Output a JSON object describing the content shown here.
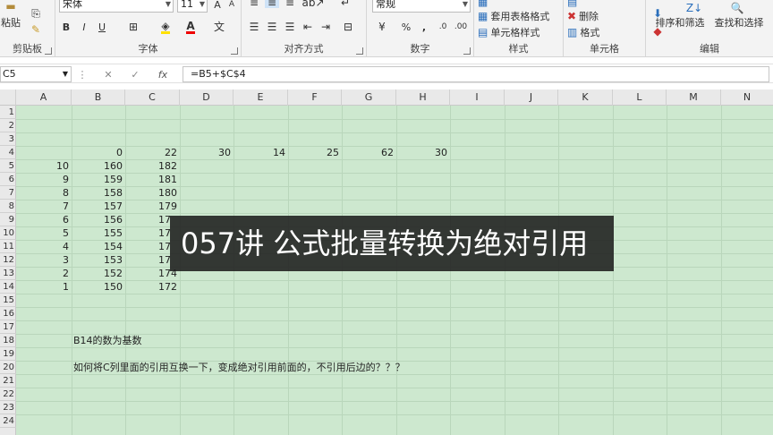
{
  "ribbon": {
    "clipboard": {
      "paste": "粘贴",
      "label": "剪贴板"
    },
    "font": {
      "name": "宋体",
      "size": "11",
      "bold": "B",
      "italic": "I",
      "underline": "U",
      "label": "字体"
    },
    "alignment": {
      "label": "对齐方式"
    },
    "number": {
      "format": "常规",
      "percent": "%",
      "comma": ",",
      "label": "数字"
    },
    "styles": {
      "table_format": "套用表格格式",
      "cell_styles": "单元格样式",
      "label": "样式"
    },
    "cells": {
      "delete": "删除",
      "format": "格式",
      "label": "单元格"
    },
    "editing": {
      "sort_filter": "排序和筛选",
      "find_select": "查找和选择",
      "label": "编辑"
    }
  },
  "formula_bar": {
    "name_box": "C5",
    "cancel": "✕",
    "enter": "✓",
    "fx": "fx",
    "formula": "=B5+$C$4"
  },
  "columns": [
    "A",
    "B",
    "C",
    "D",
    "E",
    "F",
    "G",
    "H",
    "I",
    "J",
    "K",
    "L",
    "M",
    "N"
  ],
  "rows": [
    "1",
    "2",
    "3",
    "4",
    "5",
    "6",
    "7",
    "8",
    "9",
    "10",
    "11",
    "12",
    "13",
    "14",
    "15",
    "16",
    "17",
    "18",
    "19",
    "20",
    "21",
    "22",
    "23",
    "24"
  ],
  "row4": [
    "0",
    "22",
    "30",
    "14",
    "25",
    "62",
    "30"
  ],
  "colA": [
    "10",
    "9",
    "8",
    "7",
    "6",
    "5",
    "4",
    "3",
    "2",
    "1"
  ],
  "colB": [
    "160",
    "159",
    "158",
    "157",
    "156",
    "155",
    "154",
    "153",
    "152",
    "150"
  ],
  "colC": [
    "182",
    "181",
    "180",
    "179",
    "17",
    "17",
    "17",
    "17",
    "174",
    "172"
  ],
  "note1": "B14的数为基数",
  "note2": "如何将C列里面的引用互换一下，变成绝对引用前面的，不引用后边的？？？",
  "overlay_title": "057讲 公式批量转换为绝对引用"
}
